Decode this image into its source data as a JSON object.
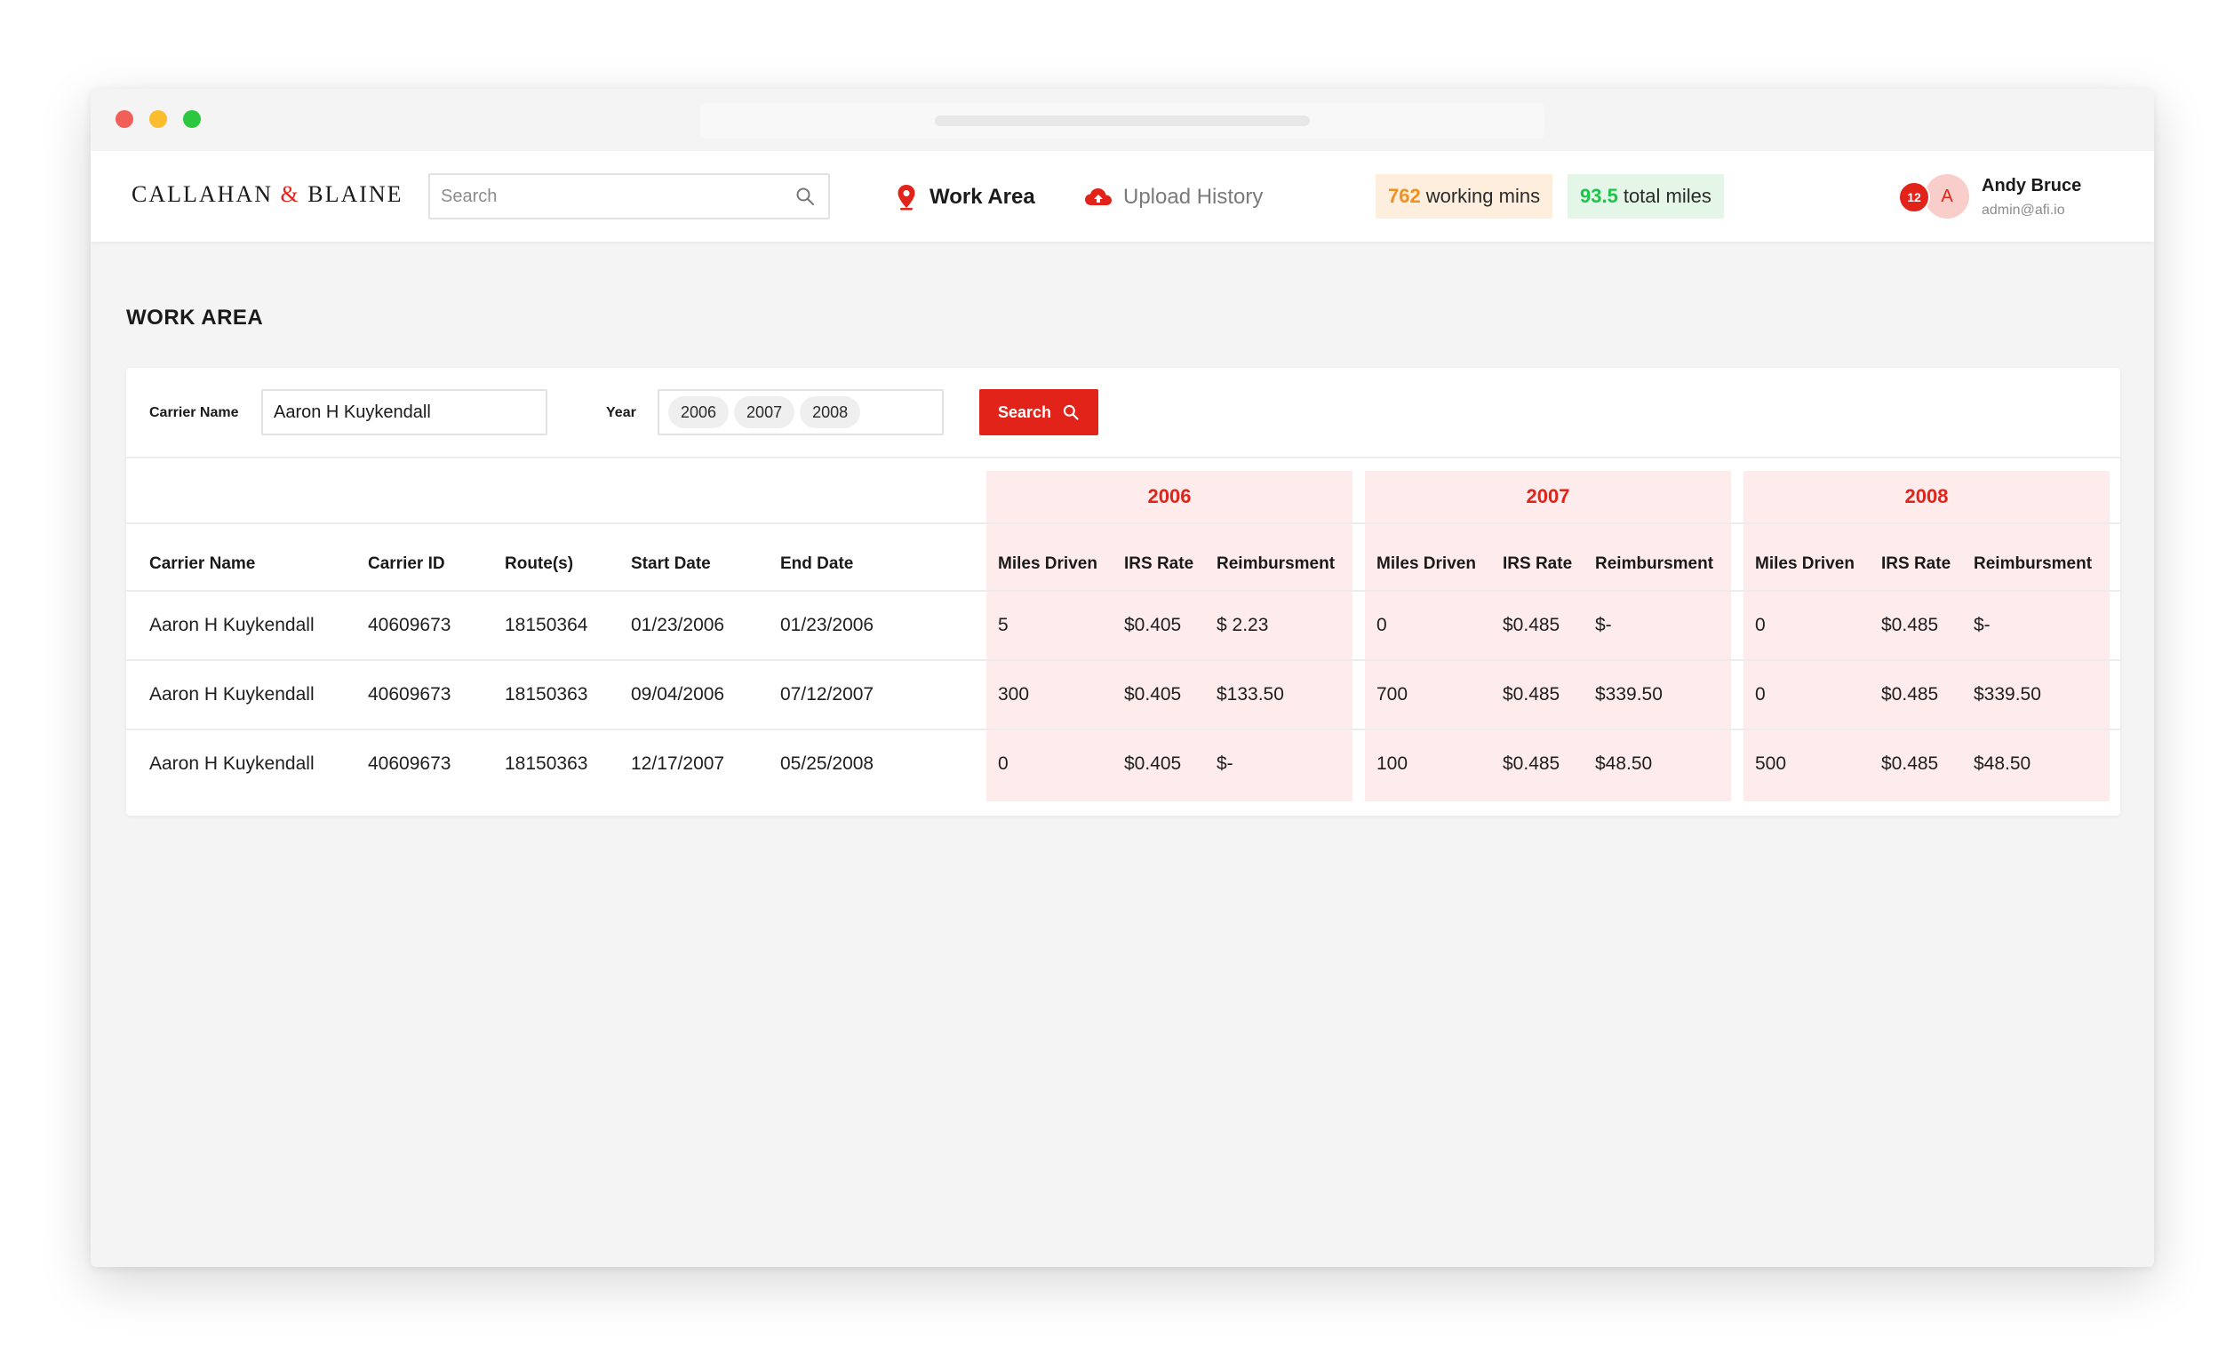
{
  "brand": {
    "logo_left": "CALLAHAN",
    "logo_amp": "&",
    "logo_right": "BLAINE"
  },
  "header": {
    "search_placeholder": "Search",
    "nav": [
      {
        "label": "Work Area",
        "icon": "map-pin-icon",
        "active": true
      },
      {
        "label": "Upload History",
        "icon": "cloud-upload-icon",
        "active": false
      }
    ],
    "stats": {
      "working_mins_value": "762",
      "working_mins_label": "working mins",
      "total_miles_value": "93.5",
      "total_miles_label": "total miles"
    },
    "user": {
      "name": "Andy Bruce",
      "email": "admin@afi.io",
      "avatar_initial": "A",
      "notification_count": "12"
    }
  },
  "page": {
    "title": "WORK AREA"
  },
  "filters": {
    "carrier_label": "Carrier Name",
    "carrier_value": "Aaron H Kuykendall",
    "year_label": "Year",
    "years": [
      "2006",
      "2007",
      "2008"
    ],
    "search_button": "Search"
  },
  "table": {
    "columns": [
      "Carrier Name",
      "Carrier ID",
      "Route(s)",
      "Start Date",
      "End Date"
    ],
    "year_groups": [
      "2006",
      "2007",
      "2008"
    ],
    "sub_columns": [
      "Miles Driven",
      "IRS Rate",
      "Reimbursment"
    ],
    "rows": [
      {
        "carrier_name": "Aaron H Kuykendall",
        "carrier_id": "40609673",
        "route": "18150364",
        "start_date": "01/23/2006",
        "end_date": "01/23/2006",
        "years": [
          {
            "miles": "5",
            "rate": "$0.405",
            "reimb": "$ 2.23"
          },
          {
            "miles": "0",
            "rate": "$0.485",
            "reimb": "$-"
          },
          {
            "miles": "0",
            "rate": "$0.485",
            "reimb": "$-"
          }
        ]
      },
      {
        "carrier_name": "Aaron H Kuykendall",
        "carrier_id": "40609673",
        "route": "18150363",
        "start_date": "09/04/2006",
        "end_date": "07/12/2007",
        "years": [
          {
            "miles": "300",
            "rate": "$0.405",
            "reimb": "$133.50"
          },
          {
            "miles": "700",
            "rate": "$0.485",
            "reimb": "$339.50"
          },
          {
            "miles": "0",
            "rate": "$0.485",
            "reimb": "$339.50"
          }
        ]
      },
      {
        "carrier_name": "Aaron H Kuykendall",
        "carrier_id": "40609673",
        "route": "18150363",
        "start_date": "12/17/2007",
        "end_date": "05/25/2008",
        "years": [
          {
            "miles": "0",
            "rate": "$0.405",
            "reimb": "$-"
          },
          {
            "miles": "100",
            "rate": "$0.485",
            "reimb": "$48.50"
          },
          {
            "miles": "500",
            "rate": "$0.485",
            "reimb": "$48.50"
          }
        ]
      }
    ]
  },
  "colors": {
    "accent": "#e2231a",
    "year_band": "#fdeceb",
    "mins_bg": "#fdeedd",
    "mins_fg": "#f0901e",
    "miles_bg": "#e3f6e7",
    "miles_fg": "#1ec44a"
  }
}
